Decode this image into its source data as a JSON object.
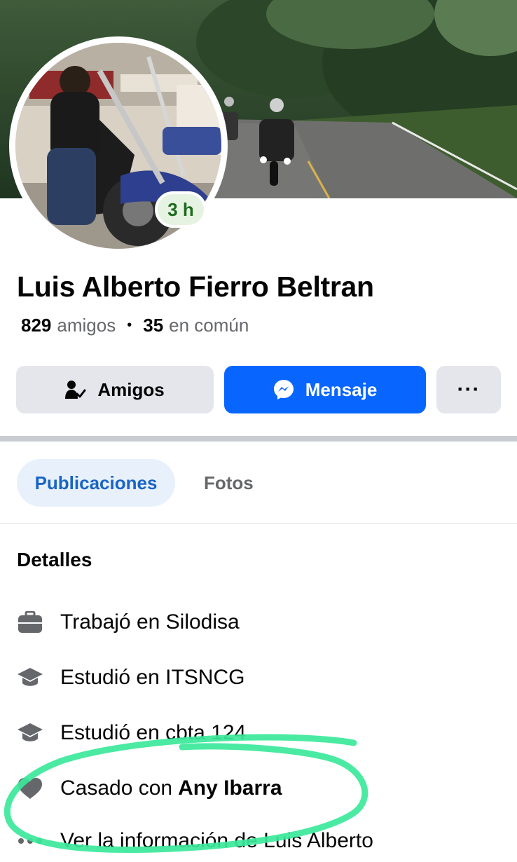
{
  "profile": {
    "name": "Luis Alberto Fierro Beltran",
    "friends_count": "829",
    "friends_label": "amigos",
    "mutual_count": "35",
    "mutual_label": "en común",
    "story_badge": "3 h"
  },
  "actions": {
    "friends_label": "Amigos",
    "message_label": "Mensaje",
    "more_label": "···"
  },
  "tabs": [
    {
      "label": "Publicaciones",
      "active": true
    },
    {
      "label": "Fotos",
      "active": false
    }
  ],
  "details": {
    "title": "Detalles",
    "items": [
      {
        "icon": "briefcase-icon",
        "text": "Trabajó en Silodisa"
      },
      {
        "icon": "graduation-cap-icon",
        "text": "Estudió en ITSNCG"
      },
      {
        "icon": "graduation-cap-icon",
        "text": "Estudió en cbta 124"
      },
      {
        "icon": "heart-icon",
        "text": "Casado con",
        "bold": "Any Ibarra"
      },
      {
        "icon": "more-icon",
        "text": "Ver la información de Luis Alberto"
      }
    ]
  },
  "colors": {
    "message_blue": "#0866ff",
    "tab_active_text": "#1a64c4",
    "highlight_circle": "#3be89a"
  }
}
